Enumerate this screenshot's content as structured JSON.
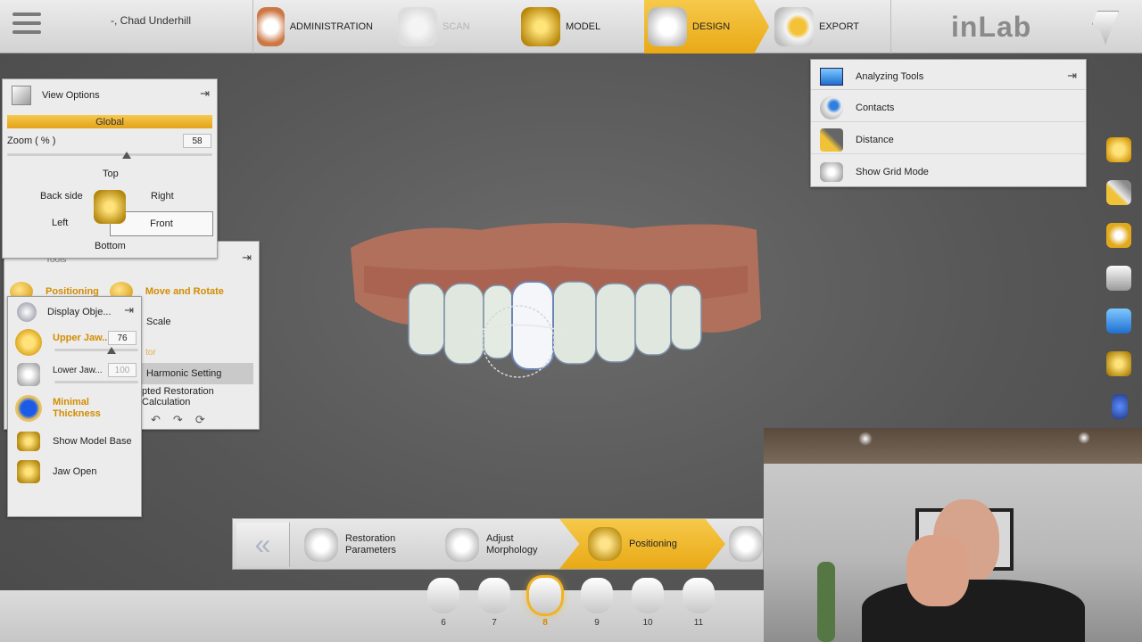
{
  "topbar": {
    "patient": "-, Chad Underhill",
    "stages": [
      {
        "label": "ADMINISTRATION",
        "state": "normal"
      },
      {
        "label": "SCAN",
        "state": "disabled"
      },
      {
        "label": "MODEL",
        "state": "normal"
      },
      {
        "label": "DESIGN",
        "state": "active"
      },
      {
        "label": "EXPORT",
        "state": "normal"
      }
    ],
    "logo": "inLab"
  },
  "view_options": {
    "title": "View Options",
    "global_label": "Global",
    "zoom_label": "Zoom ( % )",
    "zoom_value": "58",
    "views": {
      "top": "Top",
      "back": "Back side",
      "right": "Right",
      "left": "Left",
      "front": "Front",
      "bottom": "Bottom"
    }
  },
  "tools": {
    "title": "Tools",
    "positioning": "Positioning",
    "move_rotate": "Move and Rotate",
    "scale": "Scale",
    "faded": "tor",
    "harmonic": "Harmonic Setting",
    "adapted": "pted Restoration Calculation"
  },
  "display_objects": {
    "title": "Display Obje...",
    "upper_jaw": "Upper Jaw...",
    "upper_value": "76",
    "lower_jaw": "Lower Jaw...",
    "lower_value": "100",
    "minimal_thickness": "Minimal Thickness",
    "show_model_base": "Show Model Base",
    "jaw_open": "Jaw Open"
  },
  "analyzing": {
    "title": "Analyzing Tools",
    "items": [
      "Contacts",
      "Distance",
      "Show Grid Mode"
    ]
  },
  "workflow": {
    "steps": [
      {
        "label": "Restoration Parameters",
        "state": "normal"
      },
      {
        "label": "Adjust Morphology",
        "state": "normal"
      },
      {
        "label": "Positioning",
        "state": "active"
      }
    ]
  },
  "teeth": {
    "numbers": [
      "6",
      "7",
      "8",
      "9",
      "10",
      "11"
    ],
    "selected": "8"
  },
  "colors": {
    "accent": "#F0B323",
    "active_text": "#D38C00",
    "background": "#5A5A5A"
  }
}
